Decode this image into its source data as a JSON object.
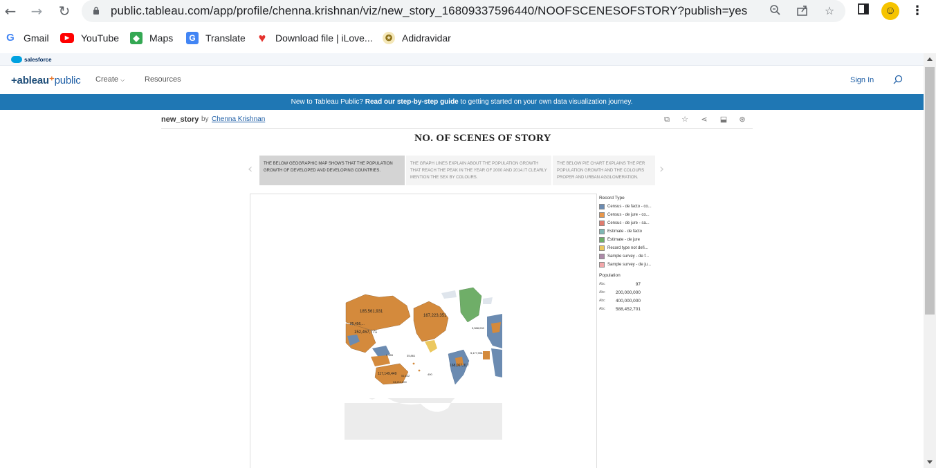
{
  "browser": {
    "url": "public.tableau.com/app/profile/chenna.krishnan/viz/new_story_16809337596440/NOOFSCENESOFSTORY?publish=yes",
    "back_icon": "arrow-left-icon",
    "forward_icon": "arrow-right-icon",
    "reload_icon": "reload-icon"
  },
  "bookmarks": [
    {
      "label": "Gmail",
      "icon": "gmail-icon",
      "color": "#4285f4"
    },
    {
      "label": "YouTube",
      "icon": "youtube-icon",
      "color": "#ff0000"
    },
    {
      "label": "Maps",
      "icon": "maps-icon",
      "color": "#34a853"
    },
    {
      "label": "Translate",
      "icon": "translate-icon",
      "color": "#4285f4"
    },
    {
      "label": "Download file | iLove...",
      "icon": "ilovepdf-icon",
      "color": "#e5322d"
    },
    {
      "label": "Adidravidar",
      "icon": "emblem-icon",
      "color": "#c9a227"
    }
  ],
  "salesforce": {
    "label": "salesforce"
  },
  "header": {
    "logo": "+ableau",
    "logo_suffix": "public",
    "nav": [
      "Create",
      "Resources"
    ],
    "sign_in": "Sign In"
  },
  "banner": {
    "prefix": "New to Tableau Public? ",
    "bold": "Read our step-by-step guide",
    "suffix": " to getting started on your own data visualization journey."
  },
  "viz": {
    "name": "new_story",
    "by": "by",
    "author": "Chenna Krishnan"
  },
  "story": {
    "title": "NO. OF SCENES OF STORY",
    "points": [
      "THE BELOW GEOGRAPHIC MAP SHOWS THAT THE POPULATION GROWTH OF DEVELOPED AND DEVELOPING COUNTRIES.",
      "THE GRAPH LINES EXPLAIN ABOUT THE POPULATION GROWTH THAT REACH THE PEAK IN THE YEAR OF 2000 AND 2014.IT CLEARLY MENTION THE SEX BY COLOURS.",
      "THE BELOW PIE CHART EXPLAINS THE PER POPULATION GROWTH AND THE COLOURS PROPER AND URBAN AGGLOMERATION."
    ]
  },
  "map_labels": [
    "185,561,931",
    "85,456,...",
    "152,457,771",
    "3,555",
    "117,149,449",
    "35,861",
    "34,211,000",
    "1,321,000",
    "3,533,000",
    "51,622",
    "400",
    "167,223,351",
    "1,759",
    "168,067,317",
    "5,177,551",
    "3,568,000"
  ],
  "legend": {
    "record_type_title": "Record Type",
    "record_types": [
      {
        "label": "Census - de facto - co...",
        "color": "#6b8bb1"
      },
      {
        "label": "Census - de jure - co...",
        "color": "#e8964a"
      },
      {
        "label": "Census - de jure - sa...",
        "color": "#e07b6e"
      },
      {
        "label": "Estimate - de facto",
        "color": "#7fb7b3"
      },
      {
        "label": "Estimate - de jure",
        "color": "#6fae68"
      },
      {
        "label": "Record type not defi...",
        "color": "#ecc85e"
      },
      {
        "label": "Sample survey - de f...",
        "color": "#ad89a8"
      },
      {
        "label": "Sample survey - de ju...",
        "color": "#f2a7aa"
      }
    ],
    "population_title": "Population",
    "population_abc": "Abc",
    "population_values": [
      "97",
      "200,000,000",
      "400,000,000",
      "588,452,701"
    ]
  }
}
